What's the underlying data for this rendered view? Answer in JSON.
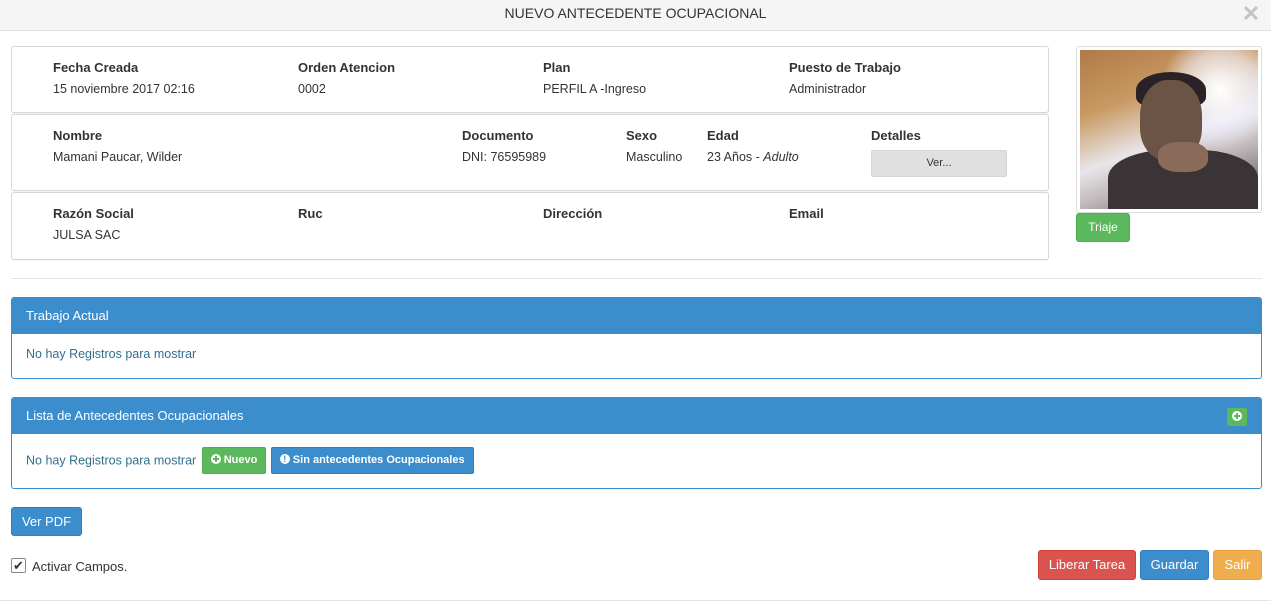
{
  "dialog": {
    "title": "NUEVO ANTECEDENTE OCUPACIONAL",
    "close_icon": "close-icon"
  },
  "row1": {
    "fecha": {
      "label": "Fecha Creada",
      "value": "15 noviembre 2017 02:16"
    },
    "orden": {
      "label": "Orden Atencion",
      "value": "0002"
    },
    "plan": {
      "label": "Plan",
      "value": "PERFIL A -Ingreso"
    },
    "puesto": {
      "label": "Puesto de Trabajo",
      "value": "Administrador"
    }
  },
  "row2": {
    "nombre": {
      "label": "Nombre",
      "value": "Mamani Paucar, Wilder"
    },
    "documento": {
      "label": "Documento",
      "value": "DNI: 76595989"
    },
    "sexo": {
      "label": "Sexo",
      "value": "Masculino"
    },
    "edad": {
      "label": "Edad",
      "value": "23 Años - ",
      "value_italic": "Adulto"
    },
    "detalles": {
      "label": "Detalles",
      "button": "Ver..."
    }
  },
  "row3": {
    "razon": {
      "label": "Razón Social",
      "value": "JULSA SAC"
    },
    "ruc": {
      "label": "Ruc",
      "value": ""
    },
    "direccion": {
      "label": "Dirección",
      "value": ""
    },
    "email": {
      "label": "Email",
      "value": ""
    }
  },
  "photo": {
    "triaje_label": "Triaje"
  },
  "panel_trabajo": {
    "title": "Trabajo Actual",
    "empty": "No hay Registros para mostrar"
  },
  "panel_lista": {
    "title": "Lista de Antecedentes Ocupacionales",
    "empty": "No hay Registros para mostrar",
    "nuevo_label": "Nuevo",
    "sin_label": "Sin antecedentes Ocupacionales"
  },
  "footer": {
    "ver_pdf": "Ver PDF",
    "activar": "Activar Campos.",
    "activar_checked": true,
    "liberar": "Liberar Tarea",
    "guardar": "Guardar",
    "salir": "Salir"
  },
  "colors": {
    "primary": "#3c8dcc",
    "success": "#5cb85c",
    "danger": "#d9534f",
    "warning": "#f0ad4e"
  }
}
